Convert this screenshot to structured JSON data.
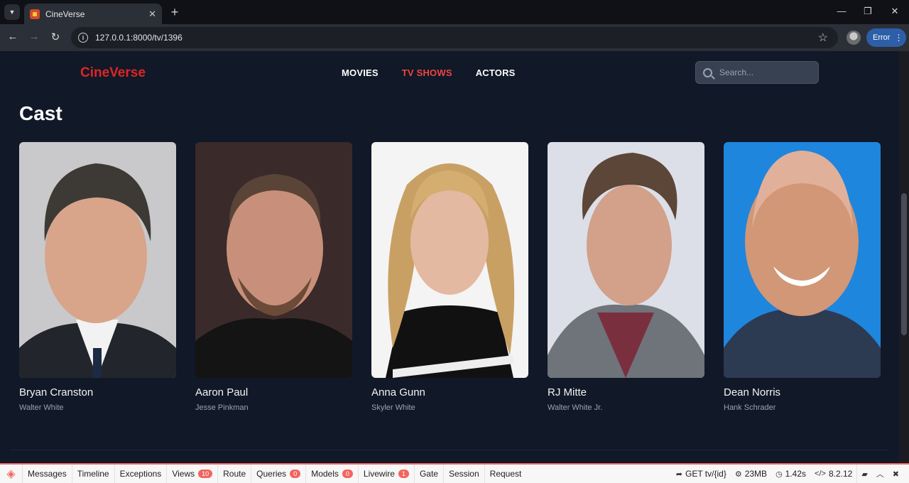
{
  "browser": {
    "tab_title": "CineVerse",
    "url": "127.0.0.1:8000/tv/1396",
    "error_label": "Error"
  },
  "site": {
    "logo": "CineVerse",
    "nav": [
      {
        "label": "MOVIES",
        "active": false
      },
      {
        "label": "TV SHOWS",
        "active": true
      },
      {
        "label": "ACTORS",
        "active": false
      }
    ],
    "search_placeholder": "Search..."
  },
  "section_title": "Cast",
  "cast": [
    {
      "name": "Bryan Cranston",
      "character": "Walter White"
    },
    {
      "name": "Aaron Paul",
      "character": "Jesse Pinkman"
    },
    {
      "name": "Anna Gunn",
      "character": "Skyler White"
    },
    {
      "name": "RJ Mitte",
      "character": "Walter White Jr."
    },
    {
      "name": "Dean Norris",
      "character": "Hank Schrader"
    }
  ],
  "debugbar": {
    "tabs": [
      {
        "label": "Messages",
        "badge": null
      },
      {
        "label": "Timeline",
        "badge": null
      },
      {
        "label": "Exceptions",
        "badge": null
      },
      {
        "label": "Views",
        "badge": "10"
      },
      {
        "label": "Route",
        "badge": null
      },
      {
        "label": "Queries",
        "badge": "0"
      },
      {
        "label": "Models",
        "badge": "0"
      },
      {
        "label": "Livewire",
        "badge": "1"
      },
      {
        "label": "Gate",
        "badge": null
      },
      {
        "label": "Session",
        "badge": null
      },
      {
        "label": "Request",
        "badge": null
      }
    ],
    "route": "GET tv/{id}",
    "memory": "23MB",
    "time": "1.42s",
    "php_version": "8.2.12"
  },
  "colors": {
    "accent": "#dc2626",
    "background": "#111827",
    "debug_accent": "#f4645f"
  }
}
